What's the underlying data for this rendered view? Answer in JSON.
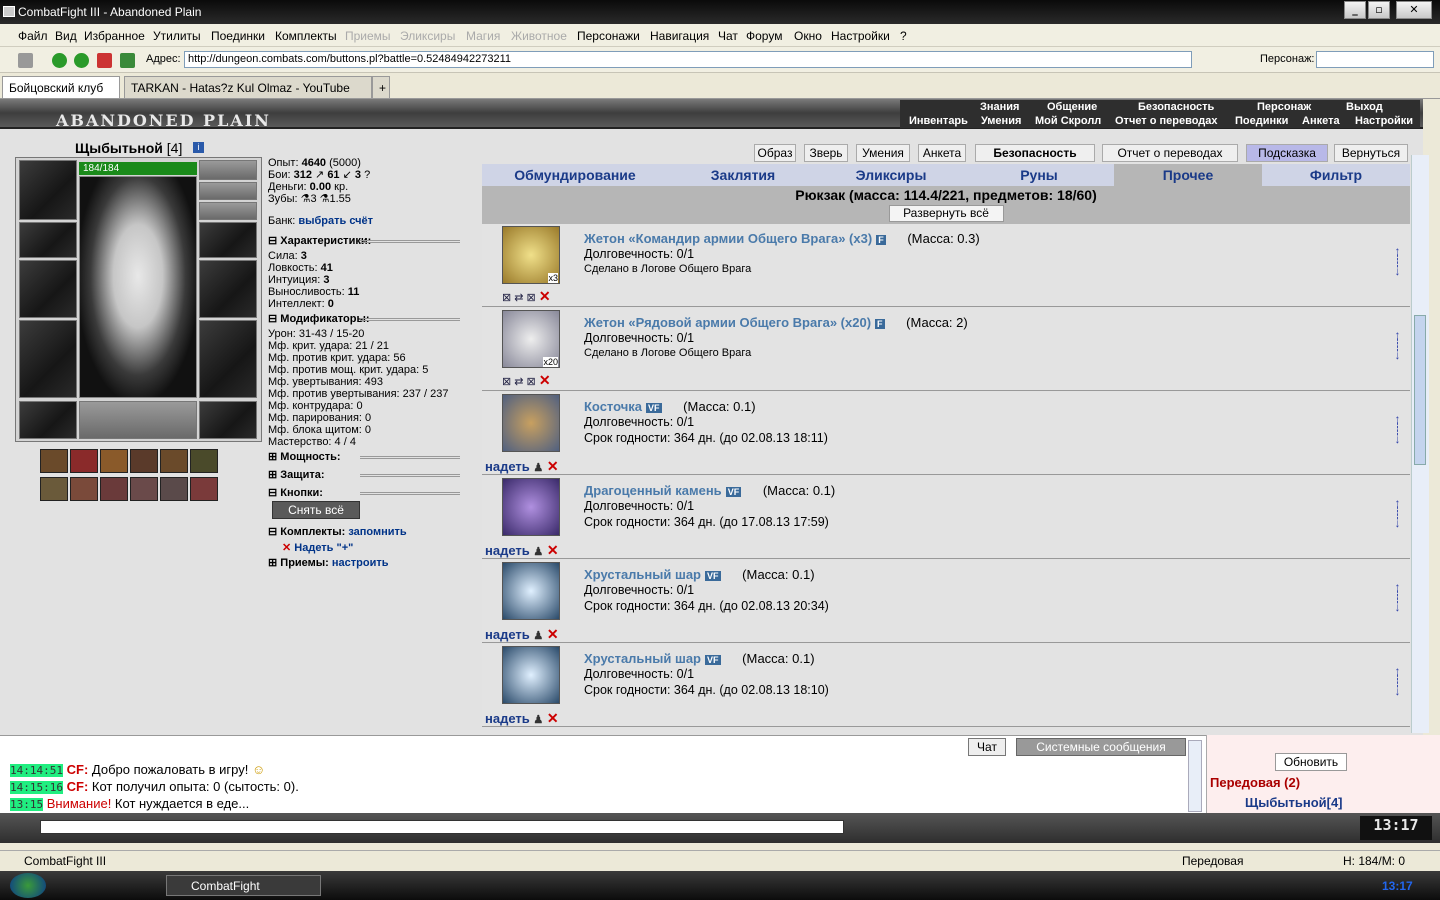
{
  "window": {
    "title": "CombatFight III - Abandoned Plain"
  },
  "menu": [
    "Файл",
    "Вид",
    "Избранное",
    "Утилиты",
    "Поединки",
    "Комплекты",
    "Приемы",
    "Эликсиры",
    "Магия",
    "Животное",
    "Персонажи",
    "Навигация",
    "Чат",
    "Форум",
    "Окно",
    "Настройки",
    "?"
  ],
  "address": {
    "label": "Адрес:",
    "url": "http://dungeon.combats.com/buttons.pl?battle=0.52484942273211",
    "persona_label": "Персонаж:"
  },
  "tabs": [
    {
      "label": "Бойцовский клуб"
    },
    {
      "label": "TARKAN - Hatas?z Kul Olmaz - YouTube"
    }
  ],
  "game": {
    "logo": "ABANDONED PLAIN",
    "nav_top": [
      "Знания",
      "Общение",
      "Безопасность",
      "Персонаж",
      "Выход"
    ],
    "nav_sub": [
      "Инвентарь",
      "Умения",
      "Мой Скролл",
      "Отчет о переводах",
      "Поединки",
      "Анкета",
      "Настройки"
    ],
    "char_name": "Щыбытьной",
    "char_level": "[4]",
    "hp": "184/184",
    "stats": {
      "exp_label": "Опыт:",
      "exp": "4640",
      "exp_next": "(5000)",
      "fights_label": "Бои:",
      "wins": "312",
      "losses": "61",
      "draws": "3",
      "money_label": "Деньги:",
      "money": "0.00",
      "money_unit": "кр.",
      "teeth_label": "Зубы:",
      "teeth": "3",
      "teeth2": "1.55",
      "bank_label": "Банк:",
      "bank_link": "выбрать счёт"
    },
    "characteristics_title": "Характеристики:",
    "characteristics": [
      [
        "Сила:",
        "3"
      ],
      [
        "Ловкость:",
        "41"
      ],
      [
        "Интуиция:",
        "3"
      ],
      [
        "Выносливость:",
        "11"
      ],
      [
        "Интеллект:",
        "0"
      ]
    ],
    "modifiers_title": "Модификаторы:",
    "modifiers": [
      "Урон: 31-43 / 15-20",
      "Мф. крит. удара: 21 / 21",
      "Мф. против крит. удара: 56",
      "Мф. против мощ. крит. удара: 5",
      "Мф. увертывания: 493",
      "Мф. против увертывания: 237 / 237",
      "Мф. контрудара: 0",
      "Мф. парирования: 0",
      "Мф. блока щитом: 0",
      "Мастерство: 4 / 4"
    ],
    "sections_collapsed": [
      "Мощность:",
      "Защита:",
      "Кнопки:"
    ],
    "take_off_all": "Снять всё",
    "sets_title": "Комплекты:",
    "sets_link": "запомнить",
    "sets_item": "Надеть \"+\"",
    "skills_title": "Приемы:",
    "skills_link": "настроить",
    "top_buttons": [
      "Образ",
      "Зверь",
      "Умения",
      "Анкета",
      "Безопасность",
      "Отчет о переводах",
      "Подсказка",
      "Вернуться"
    ],
    "inv_tabs": [
      "Обмундирование",
      "Заклятия",
      "Эликсиры",
      "Руны",
      "Прочее",
      "Фильтр"
    ],
    "backpack": "Рюкзак (масса: 114.4/221, предметов: 18/60)",
    "expand_all": "Развернуть всё",
    "items": [
      {
        "name": "Жетон «Командир армии Общего Врага» (x3)",
        "badge": "F",
        "mass": "(Масса: 0.3)",
        "dur": "Долговечность: 0/1",
        "extra": "Сделано в Логове Общего Врага",
        "qty": "x3",
        "put": ""
      },
      {
        "name": "Жетон «Рядовой армии Общего Врага» (x20)",
        "badge": "F",
        "mass": "(Масса: 2)",
        "dur": "Долговечность: 0/1",
        "extra": "Сделано в Логове Общего Врага",
        "qty": "x20",
        "put": ""
      },
      {
        "name": "Косточка",
        "badge": "VF",
        "mass": "(Масса: 0.1)",
        "dur": "Долговечность: 0/1",
        "extra": "Срок годности: 364 дн. (до 02.08.13 18:11)",
        "qty": "",
        "put": "надеть"
      },
      {
        "name": "Драгоценный камень",
        "badge": "VF",
        "mass": "(Масса: 0.1)",
        "dur": "Долговечность: 0/1",
        "extra": "Срок годности: 364 дн. (до 17.08.13 17:59)",
        "qty": "",
        "put": "надеть"
      },
      {
        "name": "Хрустальный шар",
        "badge": "VF",
        "mass": "(Масса: 0.1)",
        "dur": "Долговечность: 0/1",
        "extra": "Срок годности: 364 дн. (до 02.08.13 20:34)",
        "qty": "",
        "put": "надеть"
      },
      {
        "name": "Хрустальный шар",
        "badge": "VF",
        "mass": "(Масса: 0.1)",
        "dur": "Долговечность: 0/1",
        "extra": "Срок годности: 364 дн. (до 02.08.13 18:10)",
        "qty": "",
        "put": "надеть"
      }
    ]
  },
  "chat": {
    "tabs": [
      "Чат",
      "Системные сообщения"
    ],
    "lines": [
      {
        "time": "14:14:51",
        "who": "CF:",
        "text": " Добро пожаловать в игру!"
      },
      {
        "time": "14:15:16",
        "who": "CF:",
        "text": " Кот получил опыта: 0 (сытость: 0)."
      },
      {
        "time": "13:15",
        "who": "Внимание!",
        "text": " Кот нуждается в еде..."
      }
    ],
    "refresh": "Обновить",
    "location": "Передовая (2)",
    "player": "Щыбытьной[4]"
  },
  "clock": "13:17",
  "statusbar": {
    "app": "CombatFight III",
    "location": "Передовая",
    "hp": "H: 184/M: 0"
  },
  "taskbar": {
    "task": "CombatFight",
    "time": "13:17"
  }
}
